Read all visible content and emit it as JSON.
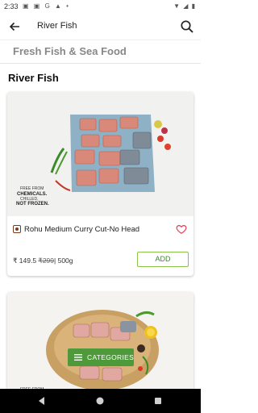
{
  "status": {
    "time": "2:33",
    "left_icons": "▣ ▣ G ▲ •",
    "right_icons": "▼ ◢ ▮"
  },
  "appbar": {
    "title": "River Fish"
  },
  "subheader": "Fresh Fish & Sea Food",
  "section_title": "River Fish",
  "products": [
    {
      "image_caption": [
        "FREE FROM",
        "CHEMICALS.",
        "CHILLED,",
        "NOT FROZEN."
      ],
      "name": "Rohu Medium Curry Cut-No Head",
      "price": "₹ 149.5",
      "mrp": "₹299",
      "unit": "| 500g",
      "add_label": "ADD"
    },
    {
      "image_caption": [
        "FREE FROM"
      ]
    }
  ],
  "categories_label": "CATEGORIES",
  "colors": {
    "accent_green": "#4e9a3b",
    "heart_red": "#e53950",
    "nav_bg": "#000000"
  },
  "icons": [
    "back-arrow-icon",
    "search-icon",
    "heart-icon",
    "hamburger-icon",
    "nav-back-icon",
    "nav-home-icon",
    "nav-recents-icon"
  ]
}
